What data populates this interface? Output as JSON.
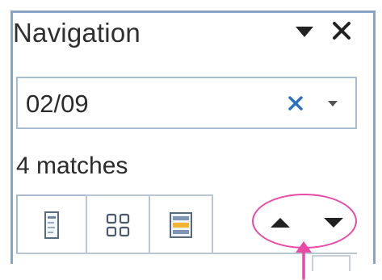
{
  "pane": {
    "title": "Navigation"
  },
  "search": {
    "value": "02/09"
  },
  "results": {
    "match_count": "4 matches"
  },
  "tabs": [
    {
      "name": "Browse headings",
      "icon": "heading-icon"
    },
    {
      "name": "Browse pages",
      "icon": "page-thumbnails-icon"
    },
    {
      "name": "Browse results",
      "icon": "search-results-icon"
    }
  ],
  "colors": {
    "title_text": "#2f2f2f",
    "border": "#8aa4c4",
    "clear_icon": "#2a6fc9",
    "annotation": "#e84aa6"
  }
}
